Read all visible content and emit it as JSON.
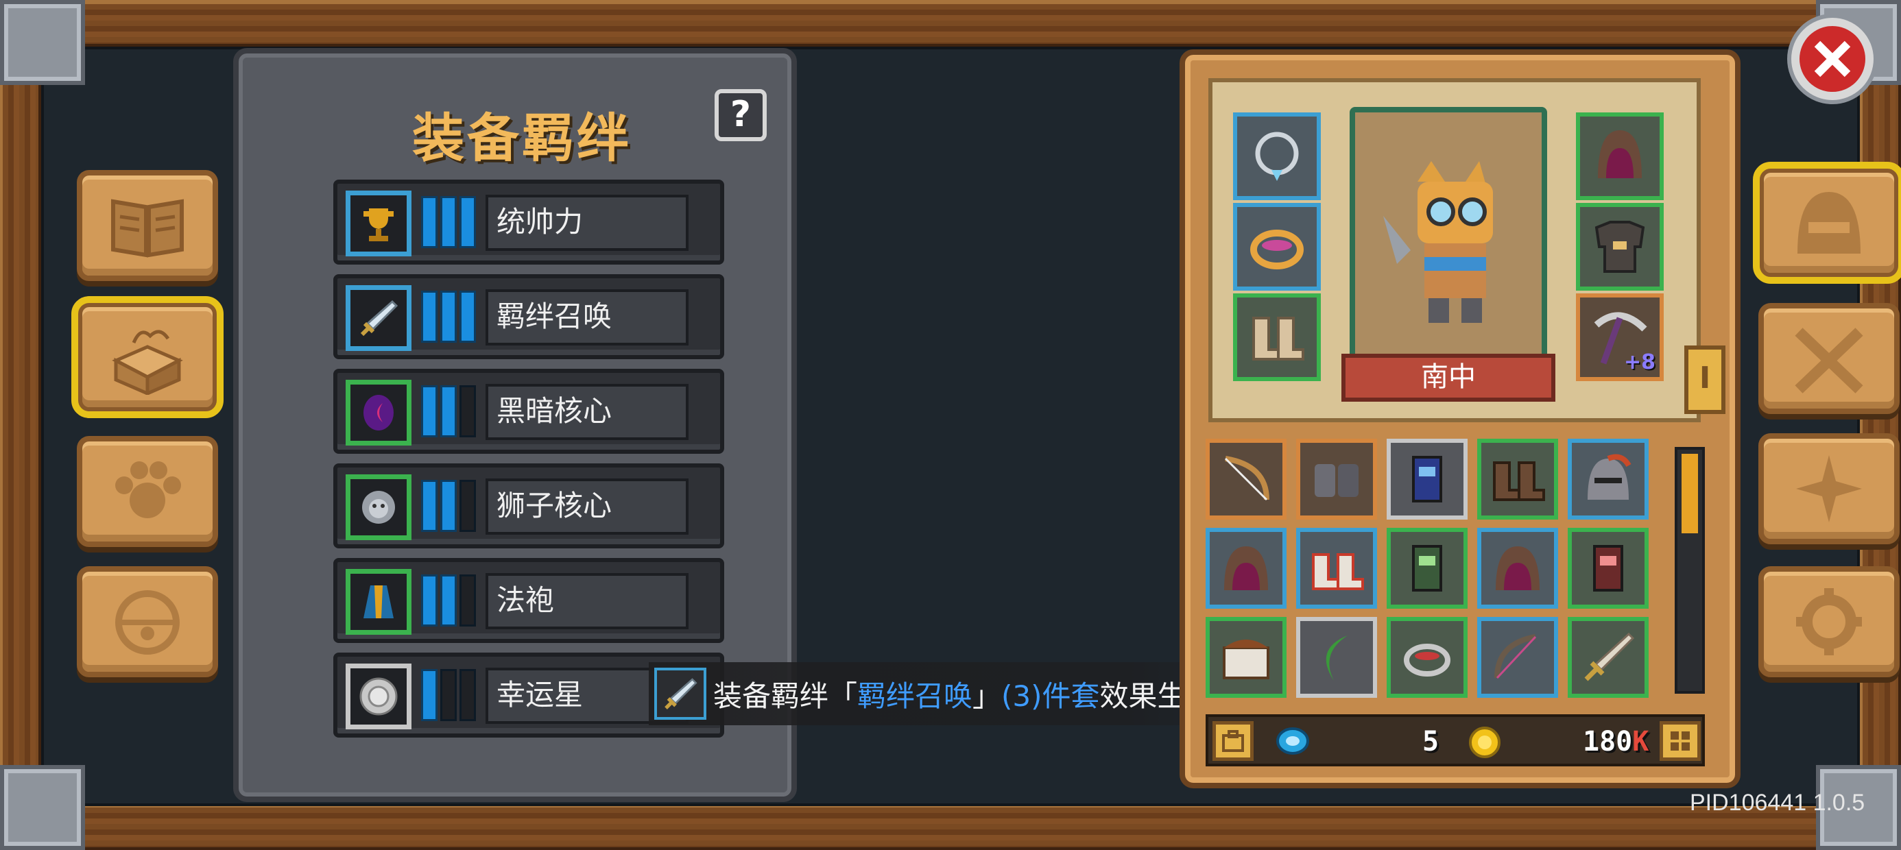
{
  "bond_panel": {
    "title": "装备羁绊",
    "help_label": "?",
    "bonds": [
      {
        "name": "统帅力",
        "icon": "trophy-icon",
        "level": 3,
        "max": 3,
        "frame": "blue"
      },
      {
        "name": "羁绊召唤",
        "icon": "sword-icon",
        "level": 3,
        "max": 3,
        "frame": "blue"
      },
      {
        "name": "黑暗核心",
        "icon": "dark-orb-icon",
        "level": 2,
        "max": 3,
        "frame": "green"
      },
      {
        "name": "狮子核心",
        "icon": "lion-head-icon",
        "level": 2,
        "max": 3,
        "frame": "green"
      },
      {
        "name": "法袍",
        "icon": "robe-icon",
        "level": 2,
        "max": 3,
        "frame": "green"
      },
      {
        "name": "幸运星",
        "icon": "lucky-star-icon",
        "level": 1,
        "max": 3,
        "frame": "grey"
      }
    ]
  },
  "tooltip": {
    "prefix": "装备羁绊「",
    "bond_name": "羁绊召唤",
    "suffix_open": "」",
    "set_text": "(3)件套",
    "effect": "效果生效"
  },
  "character": {
    "name": "南中",
    "weapon_plus": "+8",
    "side_tab": "I",
    "equipment_slots": [
      "necklace-icon",
      "ring-icon",
      "boots-icon",
      "hood-icon",
      "armor-icon",
      "pickaxe-icon"
    ]
  },
  "inventory": [
    [
      "bow-icon",
      "gauntlet-icon",
      "card-icon",
      "boots-icon",
      "helmet-icon"
    ],
    [
      "hood-icon",
      "sneakers-icon",
      "card-icon",
      "hood-icon",
      "card-icon"
    ],
    [
      "chest-icon",
      "leaf-icon",
      "ring-icon",
      "bow-icon",
      "sword-icon"
    ]
  ],
  "currency": {
    "gems": "5",
    "coins": "180",
    "coins_suffix": "K"
  },
  "version": "PID106441 1.0.5",
  "colors": {
    "blue_frame": "#3c9fd3",
    "green_frame": "#3bb24e",
    "orange_frame": "#d6873e",
    "title_gold": "#f2b95b",
    "highlight_blue": "#3f9cff"
  }
}
